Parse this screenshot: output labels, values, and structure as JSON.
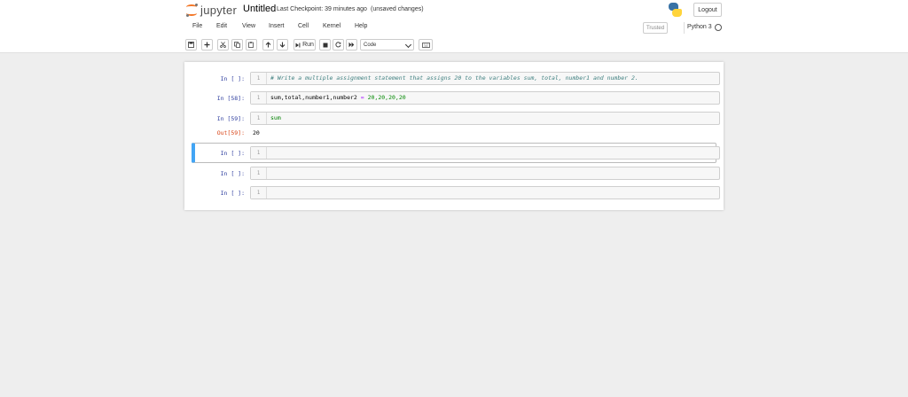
{
  "header": {
    "logo_text": "jupyter",
    "notebook_title": "Untitled",
    "checkpoint": "Last Checkpoint: 39 minutes ago",
    "unsaved": "(unsaved changes)",
    "logout_label": "Logout"
  },
  "menubar": {
    "items": [
      "File",
      "Edit",
      "View",
      "Insert",
      "Cell",
      "Kernel",
      "Help"
    ],
    "trusted_label": "Trusted",
    "kernel_name": "Python 3"
  },
  "toolbar": {
    "run_label": "Run",
    "cell_type": "Code"
  },
  "cells": [
    {
      "prompt": "In [ ]:",
      "line_no": "1",
      "code": "# Write a multiple assignment statement that assigns 20 to the variables sum, total, number1 and number 2."
    },
    {
      "prompt": "In [58]:",
      "line_no": "1",
      "code_vars": "sum,total,number1,number2",
      "code_op": " = ",
      "code_vals": "20,20,20,20"
    },
    {
      "prompt": "In [59]:",
      "line_no": "1",
      "code": "sum",
      "out_prompt": "Out[59]:",
      "output": "20"
    },
    {
      "prompt": "In [ ]:",
      "line_no": "1",
      "code": ""
    },
    {
      "prompt": "In [ ]:",
      "line_no": "1",
      "code": ""
    },
    {
      "prompt": "In [ ]:",
      "line_no": "1",
      "code": ""
    }
  ],
  "colors": {
    "accent_orange": "#f37626",
    "prompt_in": "#303f9f",
    "prompt_out": "#d84315",
    "selection_bar": "#42a5f5"
  }
}
